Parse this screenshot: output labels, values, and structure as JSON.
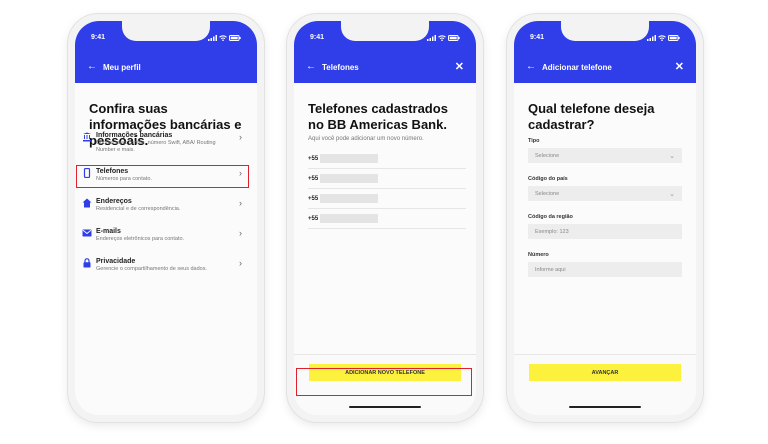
{
  "colors": {
    "accent": "#2f3ee9",
    "cta": "#fcf13c",
    "highlight": "#e0202a"
  },
  "status_time": "9:41",
  "screen1": {
    "nav_title": "Meu perfil",
    "title": "Confira suas informações bancárias e pessoais.",
    "items": [
      {
        "icon": "bank-icon",
        "label": "Informações bancárias",
        "sub": "Confira suas contas, número Swift, ABA/ Routing Number e mais."
      },
      {
        "icon": "phone-icon",
        "label": "Telefones",
        "sub": "Números para contato."
      },
      {
        "icon": "home-icon",
        "label": "Endereços",
        "sub": "Residencial e de correspondência."
      },
      {
        "icon": "mail-icon",
        "label": "E-mails",
        "sub": "Endereços eletrônicos para contato."
      },
      {
        "icon": "lock-icon",
        "label": "Privacidade",
        "sub": "Gerencie o compartilhamento de seus dados."
      }
    ]
  },
  "screen2": {
    "nav_title": "Telefones",
    "title": "Telefones cadastrados no BB Americas Bank.",
    "intro": "Aqui você pode adicionar um novo número.",
    "phones": [
      "+55",
      "+55",
      "+55",
      "+55"
    ],
    "cta": "ADICIONAR NOVO TELEFONE"
  },
  "screen3": {
    "nav_title": "Adicionar telefone",
    "title": "Qual telefone deseja cadastrar?",
    "fields": [
      {
        "label": "Tipo",
        "value": "Selecione"
      },
      {
        "label": "Código do país",
        "value": "Selecione"
      },
      {
        "label": "Código da região",
        "value": "Exemplo: 123"
      },
      {
        "label": "Número",
        "value": "Informe aqui"
      }
    ],
    "cta": "AVANÇAR"
  }
}
